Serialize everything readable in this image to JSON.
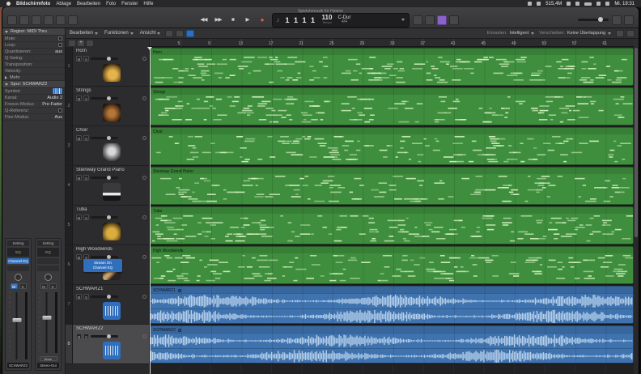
{
  "menubar": {
    "app": "Bildschirmfoto",
    "menus": [
      "Ablage",
      "Bearbeiten",
      "Foto",
      "Fenster",
      "Hilfe"
    ],
    "status_items": [
      {
        "type": "icon",
        "name": "display-icon"
      },
      {
        "type": "icon",
        "name": "volume-icon"
      },
      {
        "type": "text",
        "value": "515,4M"
      },
      {
        "type": "icon",
        "name": "bluetooth-icon"
      },
      {
        "type": "icon",
        "name": "wifi-icon"
      },
      {
        "type": "icon",
        "name": "battery-icon"
      },
      {
        "type": "icon",
        "name": "spotlight-icon"
      },
      {
        "type": "icon",
        "name": "control-center-icon"
      },
      {
        "type": "text",
        "value": "Mi. 19:31"
      }
    ]
  },
  "window": {
    "title": "Spieluhrmusik für Helene"
  },
  "transport": {
    "rewind": "◀◀",
    "forward": "▶▶",
    "stop": "■",
    "play": "▶",
    "record": "●",
    "lcd": {
      "note_icon": "♪",
      "position": "1 1 1 1",
      "tempo": "110",
      "tempo_label": "Tempo",
      "key": "C-Dur",
      "timesig": "4/4"
    }
  },
  "toolbar2": {
    "menus": [
      "Bearbeiten",
      "Funktionen",
      "Ansicht"
    ],
    "snap_label": "Einrasten:",
    "snap_value": "Intelligent",
    "drag_label": "Verschieben:",
    "drag_value": "Keine Überlappung"
  },
  "inspector": {
    "region_header": "Region: MIDI Thru",
    "region_rows": [
      {
        "label": "Mute:",
        "control": "checkbox"
      },
      {
        "label": "Loop:",
        "control": "checkbox"
      },
      {
        "label": "Quantisieren:",
        "value": "aus"
      },
      {
        "label": "Q-Swing:",
        "value": ""
      },
      {
        "label": "Transposition:",
        "value": ""
      },
      {
        "label": "Velocity:",
        "value": ""
      }
    ],
    "more_label": "Mehr",
    "track_header": "Spur: SCHWARZ2",
    "track_rows": [
      {
        "label": "Symbol:",
        "control": "icon"
      },
      {
        "label": "Kanal:",
        "value": "Audio 2"
      },
      {
        "label": "Freeze-Modus:",
        "value": "Pre-Fader"
      },
      {
        "label": "Q-Referenz:",
        "control": "checkbox"
      },
      {
        "label": "Flex-Modus:",
        "value": "Aus"
      }
    ]
  },
  "mixer": {
    "left": {
      "setting": "Setting",
      "eq": "EQ",
      "insert": "Channel EQ",
      "mute": "M",
      "solo": "S",
      "name": "SCHWARZ2"
    },
    "right": {
      "setting": "Setting",
      "eq": "EQ",
      "mute": "M",
      "solo": "S",
      "bounce": "Bnce",
      "name": "Stereo-Out"
    }
  },
  "track_badge": {
    "line1": "Stream On",
    "line2": "Channel EQ"
  },
  "ruler_numbers": [
    "5",
    "9",
    "13",
    "17",
    "21",
    "25",
    "29",
    "33",
    "37",
    "41",
    "45",
    "49",
    "53",
    "57",
    "61"
  ],
  "track_controls": {
    "mute": "M",
    "solo": "S"
  },
  "tracks": [
    {
      "num": "1",
      "name": "Horn",
      "icon": "horn-icon",
      "kind": "midi",
      "region_label": "Horn",
      "selected": false
    },
    {
      "num": "2",
      "name": "Strings",
      "icon": "strings-icon",
      "kind": "midi",
      "region_label": "Strings",
      "selected": false
    },
    {
      "num": "3",
      "name": "Choir",
      "icon": "choir-icon",
      "kind": "midi",
      "region_label": "Choir",
      "selected": false
    },
    {
      "num": "4",
      "name": "Steinway Grand Piano",
      "icon": "piano-icon",
      "kind": "midi",
      "region_label": "Steinway Grand Piano",
      "selected": false
    },
    {
      "num": "5",
      "name": "Tuba",
      "icon": "tuba-icon",
      "kind": "midi",
      "region_label": "Tuba",
      "selected": false
    },
    {
      "num": "6",
      "name": "High Woodwinds",
      "icon": "flute-icon",
      "kind": "midi",
      "region_label": "High Woodwinds",
      "selected": false
    },
    {
      "num": "7",
      "name": "SCHWARZ1",
      "icon": "audio-waveform-icon",
      "kind": "audio",
      "region_label": "SCHWARZ1",
      "selected": false
    },
    {
      "num": "8",
      "name": "SCHWARZ2",
      "icon": "audio-waveform-icon",
      "kind": "audio",
      "region_label": "SCHWARZ2",
      "selected": true
    }
  ],
  "colors": {
    "midi_region": "#3e8e3e",
    "audio_region": "#3f73b0",
    "midi_note": "#d6f2c2",
    "waveform": "#cde2f6",
    "accent_blue": "#2f6fbe",
    "record_red": "#e05a4f",
    "purple_button": "#8a63c9"
  }
}
